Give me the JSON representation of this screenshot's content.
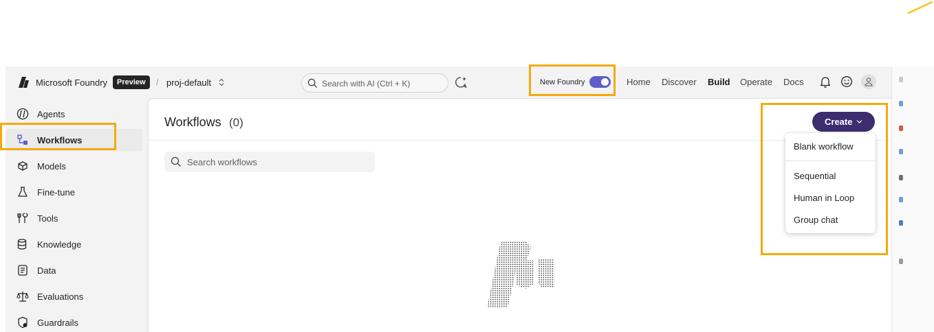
{
  "topbar": {
    "brand": "Microsoft Foundry",
    "badge": "Preview",
    "separator": "/",
    "project": "proj-default",
    "search_placeholder": "Search with AI (Ctrl + K)",
    "new_foundry_label": "New Foundry",
    "new_foundry_enabled": true,
    "nav": [
      {
        "label": "Home",
        "active": false
      },
      {
        "label": "Discover",
        "active": false
      },
      {
        "label": "Build",
        "active": true
      },
      {
        "label": "Operate",
        "active": false
      },
      {
        "label": "Docs",
        "active": false
      }
    ],
    "icons": [
      "bell-icon",
      "smiley-feedback-icon",
      "profile-icon"
    ]
  },
  "sidebar": {
    "items": [
      {
        "label": "Agents",
        "icon": "agents-icon",
        "selected": false
      },
      {
        "label": "Workflows",
        "icon": "workflow-icon",
        "selected": true
      },
      {
        "label": "Models",
        "icon": "cubes-icon",
        "selected": false
      },
      {
        "label": "Fine-tune",
        "icon": "flask-icon",
        "selected": false
      },
      {
        "label": "Tools",
        "icon": "tools-icon",
        "selected": false
      },
      {
        "label": "Knowledge",
        "icon": "database-icon",
        "selected": false
      },
      {
        "label": "Data",
        "icon": "document-icon",
        "selected": false
      },
      {
        "label": "Evaluations",
        "icon": "scale-icon",
        "selected": false
      },
      {
        "label": "Guardrails",
        "icon": "shield-icon",
        "selected": false
      }
    ]
  },
  "main": {
    "title": "Workflows",
    "count": "(0)",
    "search_placeholder": "Search workflows",
    "create_label": "Create",
    "create_menu": {
      "items": [
        "Blank workflow",
        "Sequential",
        "Human in Loop",
        "Group chat"
      ]
    }
  },
  "colors": {
    "accent": "#5b5fc7",
    "create_button": "#3b2d6e",
    "highlight": "#f5a90a",
    "app_background": "#f3f3f3"
  }
}
